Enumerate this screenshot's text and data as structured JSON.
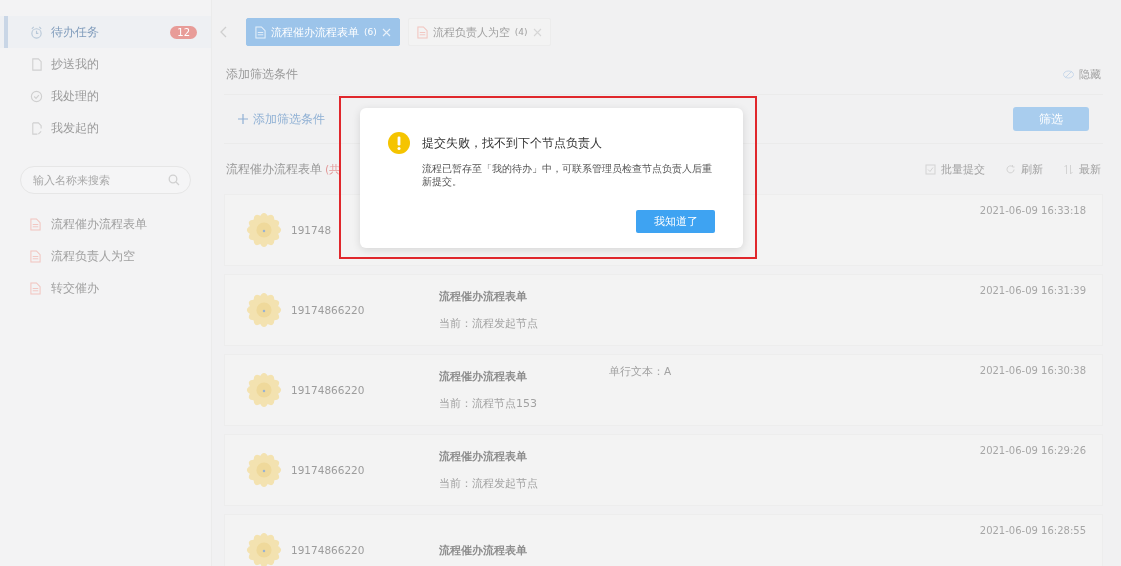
{
  "sidebar": {
    "items": [
      {
        "label": "待办任务",
        "badge": "12",
        "selected": true
      },
      {
        "label": "抄送我的",
        "selected": false
      },
      {
        "label": "我处理的",
        "selected": false
      },
      {
        "label": "我发起的",
        "selected": false
      }
    ],
    "search": {
      "placeholder": "输入名称来搜索"
    },
    "forms": [
      {
        "label": "流程催办流程表单"
      },
      {
        "label": "流程负责人为空"
      },
      {
        "label": "转交催办"
      }
    ]
  },
  "tabs": [
    {
      "label": "流程催办流程表单",
      "count": "(6)",
      "selected": true
    },
    {
      "label": "流程负责人为空",
      "count": "(4)",
      "selected": false
    }
  ],
  "filter": {
    "title": "添加筛选条件",
    "hide": "隐藏",
    "add": "添加筛选条件",
    "button": "筛选"
  },
  "list": {
    "title": "流程催办流程表单",
    "count": "(共",
    "actions": [
      "批量提交",
      "刷新",
      "最新"
    ],
    "rows": [
      {
        "phone": "191748",
        "date": "2021-06-09 16:33:18"
      },
      {
        "phone": "19174866220",
        "title": "流程催办流程表单",
        "subtitle": "当前：流程发起节点",
        "date": "2021-06-09 16:31:39"
      },
      {
        "phone": "19174866220",
        "title": "流程催办流程表单",
        "subtitle": "当前：流程节点153",
        "extra": "单行文本：A",
        "date": "2021-06-09 16:30:38"
      },
      {
        "phone": "19174866220",
        "title": "流程催办流程表单",
        "subtitle": "当前：流程发起节点",
        "date": "2021-06-09 16:29:26"
      },
      {
        "phone": "19174866220",
        "title": "流程催办流程表单",
        "date": "2021-06-09 16:28:55"
      }
    ]
  },
  "dialog": {
    "title": "提交失败，找不到下个节点负责人",
    "message": "流程已暂存至「我的待办」中，可联系管理员检查节点负责人后重新提交。",
    "button": "我知道了"
  }
}
